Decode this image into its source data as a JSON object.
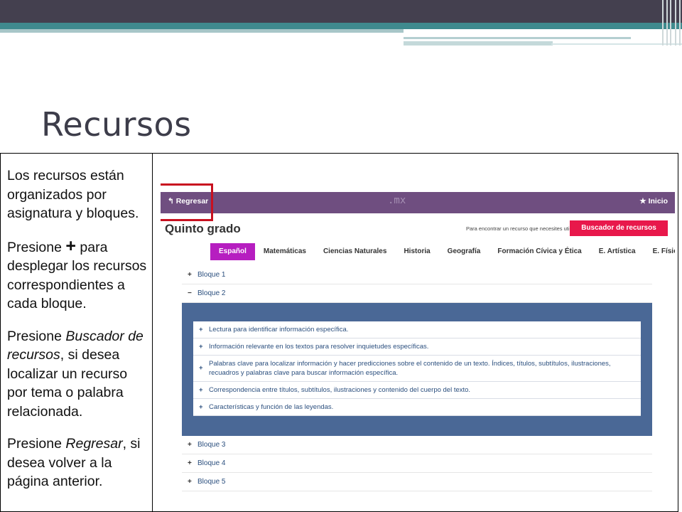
{
  "slide": {
    "title": "Recursos"
  },
  "instructions": {
    "p1": "Los recursos están organizados por asignatura y bloques.",
    "p2_pre": "Presione ",
    "p2_symbol": "+",
    "p2_post": " para desplegar los recursos correspondientes a cada bloque.",
    "p3_pre": "Presione ",
    "p3_em": "Buscador de recursos",
    "p3_post": ", si desea localizar un recurso por tema o palabra relacionada.",
    "p4_pre": "Presione ",
    "p4_em": "Regresar",
    "p4_post": ", si desea volver a la página anterior."
  },
  "site": {
    "back_label": "↰ Regresar",
    "brand": ".mx",
    "home_label": "★ Inicio",
    "grade_title": "Quinto grado",
    "search_prompt": "Para encontrar un recurso que necesites utiliza el",
    "search_button": "Buscador de recursos",
    "tabs": [
      {
        "label": "Español",
        "active": true
      },
      {
        "label": "Matemáticas",
        "active": false
      },
      {
        "label": "Ciencias Naturales",
        "active": false
      },
      {
        "label": "Historia",
        "active": false
      },
      {
        "label": "Geografía",
        "active": false
      },
      {
        "label": "Formación Cívica y Ética",
        "active": false
      },
      {
        "label": "E. Artística",
        "active": false
      },
      {
        "label": "E. Física",
        "active": false
      }
    ],
    "blocks_before": [
      {
        "symbol": "+",
        "label": "Bloque 1"
      },
      {
        "symbol": "−",
        "label": "Bloque 2"
      }
    ],
    "resources": [
      "Lectura para identificar información específica.",
      "Información relevante en los textos para resolver inquietudes específicas.",
      "Palabras clave para localizar información y hacer predicciones sobre el contenido de un texto. Índices, títulos, subtítulos, ilustraciones, recuadros y palabras clave para buscar información específica.",
      "Correspondencia entre títulos, subtítulos, ilustraciones y contenido del cuerpo del texto.",
      "Características y función de las leyendas."
    ],
    "blocks_after": [
      {
        "symbol": "+",
        "label": "Bloque 3"
      },
      {
        "symbol": "+",
        "label": "Bloque 4"
      },
      {
        "symbol": "+",
        "label": "Bloque 5"
      }
    ]
  },
  "colors": {
    "header_bar": "#6f4e80",
    "search_button": "#e8184b",
    "active_tab": "#b61ec0",
    "expanded_panel": "#4a6896",
    "highlight": "#c8101f"
  }
}
